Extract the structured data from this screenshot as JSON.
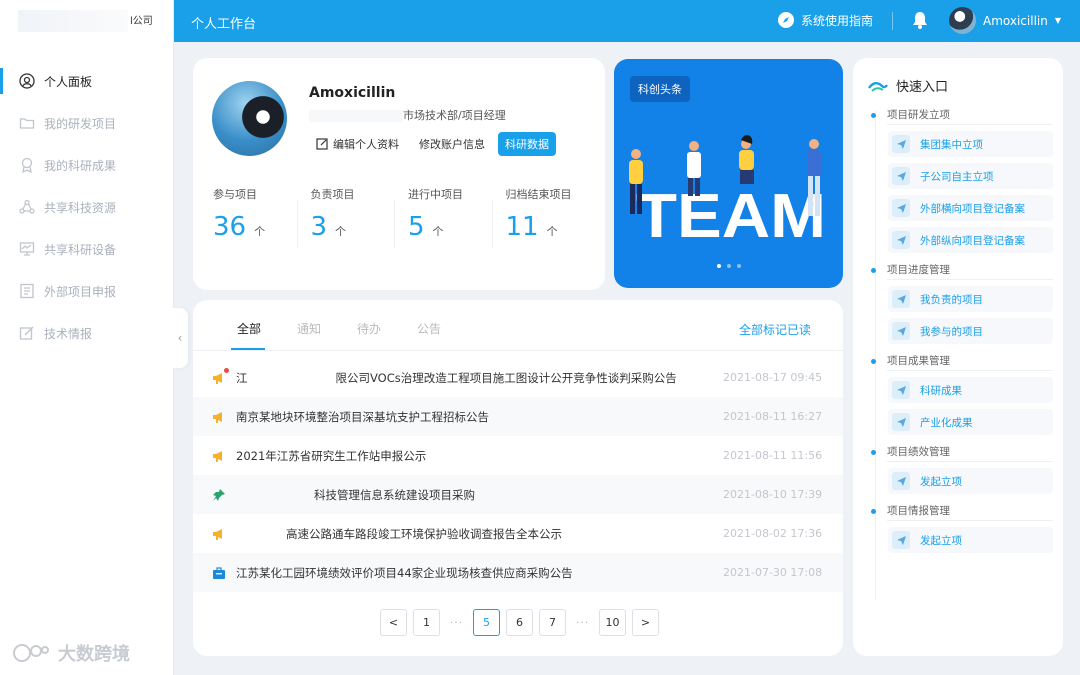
{
  "logo": {
    "text": "l公司"
  },
  "sidebar": {
    "items": [
      {
        "label": "个人面板",
        "icon": "user-circle-icon",
        "active": true
      },
      {
        "label": "我的研发项目",
        "icon": "folder-icon",
        "active": false
      },
      {
        "label": "我的科研成果",
        "icon": "award-icon",
        "active": false
      },
      {
        "label": "共享科技资源",
        "icon": "share-icon",
        "active": false
      },
      {
        "label": "共享科研设备",
        "icon": "monitor-icon",
        "active": false
      },
      {
        "label": "外部项目申报",
        "icon": "document-icon",
        "active": false
      },
      {
        "label": "技术情报",
        "icon": "edit-icon",
        "active": false
      }
    ]
  },
  "watermark": "大数跨境",
  "topbar": {
    "title": "个人工作台",
    "guide_label": "系统使用指南",
    "username": "Amoxicillin"
  },
  "profile": {
    "name": "Amoxicillin",
    "dept": "市场技术部/项目经理",
    "actions": {
      "edit": "编辑个人资料",
      "account": "修改账户信息",
      "research": "科研数据"
    },
    "stats": [
      {
        "label": "参与项目",
        "value": "36",
        "unit": "个"
      },
      {
        "label": "负责项目",
        "value": "3",
        "unit": "个"
      },
      {
        "label": "进行中项目",
        "value": "5",
        "unit": "个"
      },
      {
        "label": "归档结束项目",
        "value": "11",
        "unit": "个"
      }
    ]
  },
  "banner": {
    "tag": "科创头条",
    "image_text": "TEAM",
    "dots": 3,
    "active_dot": 0
  },
  "notices": {
    "tabs": [
      "全部",
      "通知",
      "待办",
      "公告"
    ],
    "active_tab": 0,
    "mark_all_read": "全部标记已读",
    "items": [
      {
        "prefix": "江",
        "title": "限公司VOCs治理改造工程项目施工图设计公开竞争性谈判采购公告",
        "date": "2021-08-17 09:45",
        "icon": "megaphone-icon",
        "unread": true
      },
      {
        "prefix": "",
        "title": "南京某地块环境整治项目深基坑支护工程招标公告",
        "date": "2021-08-11 16:27",
        "icon": "megaphone-icon",
        "unread": false
      },
      {
        "prefix": "",
        "title": "2021年江苏省研究生工作站申报公示",
        "date": "2021-08-11 11:56",
        "icon": "megaphone-icon",
        "unread": false
      },
      {
        "prefix": "",
        "title": "科技管理信息系统建设项目采购",
        "date": "2021-08-10 17:39",
        "icon": "pin-icon",
        "unread": false
      },
      {
        "prefix": "",
        "title": "高速公路通车路段竣工环境保护验收调查报告全本公示",
        "date": "2021-08-02 17:36",
        "icon": "megaphone-icon",
        "unread": false
      },
      {
        "prefix": "",
        "title": "江苏某化工园环境绩效评价项目44家企业现场核查供应商采购公告",
        "date": "2021-07-30 17:08",
        "icon": "briefcase-icon",
        "unread": false
      }
    ]
  },
  "pagination": {
    "prev": "<",
    "next": ">",
    "pages": [
      "1",
      "5",
      "6",
      "7",
      "10"
    ],
    "current": "5",
    "ellipsis": "···"
  },
  "quick": {
    "title": "快速入口",
    "sections": [
      {
        "label": "项目研发立项",
        "items": [
          "集团集中立项",
          "子公司自主立项",
          "外部横向项目登记备案",
          "外部纵向项目登记备案"
        ]
      },
      {
        "label": "项目进度管理",
        "items": [
          "我负责的项目",
          "我参与的项目"
        ]
      },
      {
        "label": "项目成果管理",
        "items": [
          "科研成果",
          "产业化成果"
        ]
      },
      {
        "label": "项目绩效管理",
        "items": [
          "发起立项"
        ]
      },
      {
        "label": "项目情报管理",
        "items": [
          "发起立项"
        ]
      }
    ]
  },
  "colors": {
    "accent": "#1aa0e8",
    "banner": "#1382e8",
    "unread": "#e84a4a"
  }
}
